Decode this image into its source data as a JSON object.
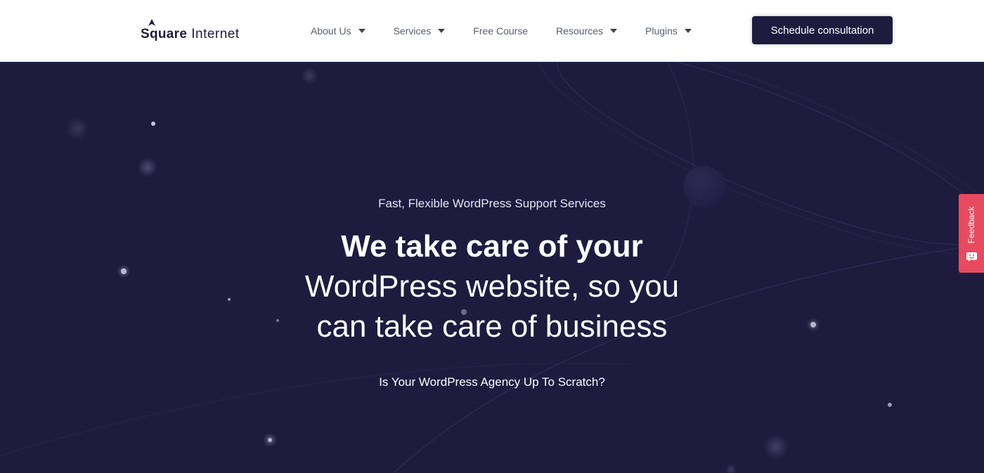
{
  "header": {
    "logo_bold": "Square",
    "logo_light": "Internet",
    "nav": [
      {
        "label": "About Us",
        "has_dropdown": true
      },
      {
        "label": "Services",
        "has_dropdown": true
      },
      {
        "label": "Free Course",
        "has_dropdown": false
      },
      {
        "label": "Resources",
        "has_dropdown": true
      },
      {
        "label": "Plugins",
        "has_dropdown": true
      }
    ],
    "cta_label": "Schedule consultation"
  },
  "hero": {
    "eyebrow": "Fast, Flexible WordPress Support Services",
    "headline_bold": "We take care of your",
    "headline_line2": "WordPress website, so you",
    "headline_line3": "can take care of business",
    "subline": "Is Your WordPress Agency Up To Scratch?"
  },
  "feedback": {
    "label": "Feedback",
    "icon": "feedback-face-icon"
  },
  "colors": {
    "brand_dark": "#1e1b3f",
    "feedback_red": "#e84a5f",
    "header_bg": "#ffffff"
  },
  "icons": {
    "logo": "rocket-logo-icon",
    "dropdown": "caret-down-icon"
  }
}
